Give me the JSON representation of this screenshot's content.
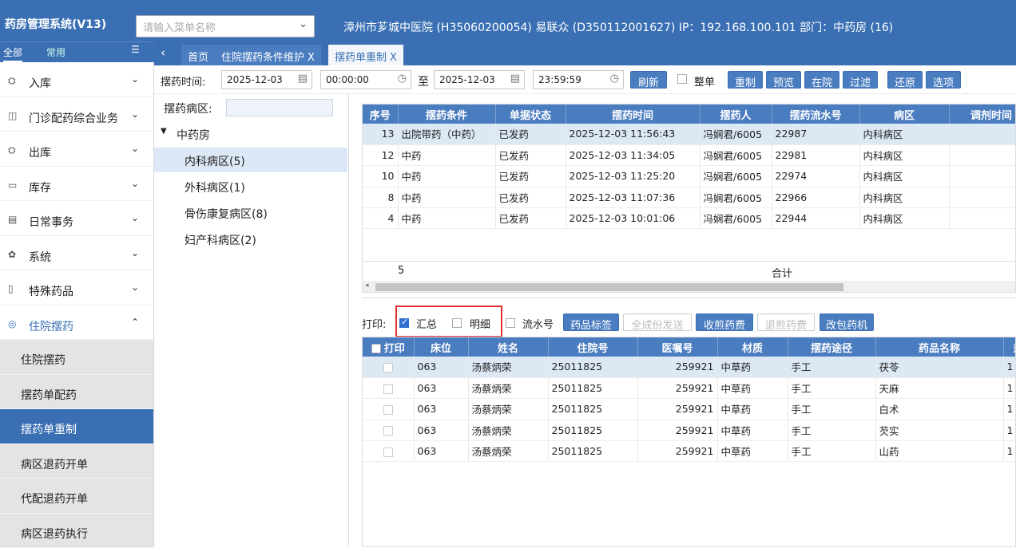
{
  "app": {
    "title": "药房管理系统(V13)",
    "menu_search_placeholder": "请输入菜单名称",
    "hospital_info": "漳州市芗城中医院 (H35060200054) 易联众 (D350112001627) IP：192.168.100.101 部门：中药房 (16)"
  },
  "sidetabs": {
    "all": "全部",
    "common": "常用"
  },
  "sidebar": {
    "menus": [
      {
        "label": "入库",
        "icon": "⛭",
        "arrow": "⌄"
      },
      {
        "label": "门诊配药综合业务",
        "icon": "◫",
        "arrow": "⌄"
      },
      {
        "label": "出库",
        "icon": "⛭",
        "arrow": "⌄"
      },
      {
        "label": "库存",
        "icon": "▭",
        "arrow": "⌄"
      },
      {
        "label": "日常事务",
        "icon": "▤",
        "arrow": "⌄"
      },
      {
        "label": "系统",
        "icon": "✿",
        "arrow": "⌄"
      },
      {
        "label": "特殊药品",
        "icon": "▯",
        "arrow": "⌄"
      },
      {
        "label": "住院摆药",
        "icon": "◎",
        "arrow": "⌃"
      }
    ],
    "subitems": [
      "住院摆药",
      "摆药单配药",
      "摆药单重制",
      "病区退药开单",
      "代配退药开单",
      "病区退药执行"
    ],
    "selected_subitem": "摆药单重制"
  },
  "tabs": [
    {
      "label": "首页"
    },
    {
      "label": "住院摆药条件维护",
      "close": "X"
    },
    {
      "label": "摆药单重制",
      "close": "X"
    }
  ],
  "toolbar": {
    "time_label": "摆药时间:",
    "start_date": "2025-12-03",
    "start_time": "00:00:00",
    "to_label": "至",
    "end_date": "2025-12-03",
    "end_time": "23:59:59",
    "refresh": "刷新",
    "whole_label": "整单",
    "whole_checked": false,
    "buttons": [
      "重制",
      "预览",
      "在院",
      "过滤",
      "还原",
      "选项"
    ]
  },
  "ward_panel": {
    "label": "摆药病区:",
    "root": "中药房",
    "wards": [
      "内科病区(5)",
      "外科病区(1)",
      "骨伤康复病区(8)",
      "妇产科病区(2)"
    ],
    "selected": "内科病区(5)"
  },
  "top_table": {
    "headers": [
      "序号",
      "摆药条件",
      "单据状态",
      "摆药时间",
      "摆药人",
      "摆药流水号",
      "病区",
      "调剂时间"
    ],
    "rows": [
      [
        "13",
        "出院带药（中药）",
        "已发药",
        "2025-12-03 11:56:43",
        "冯娴君/6005",
        "22987",
        "内科病区",
        ""
      ],
      [
        "12",
        "中药",
        "已发药",
        "2025-12-03 11:34:05",
        "冯娴君/6005",
        "22981",
        "内科病区",
        ""
      ],
      [
        "10",
        "中药",
        "已发药",
        "2025-12-03 11:25:20",
        "冯娴君/6005",
        "22974",
        "内科病区",
        ""
      ],
      [
        "8",
        "中药",
        "已发药",
        "2025-12-03 11:07:36",
        "冯娴君/6005",
        "22966",
        "内科病区",
        ""
      ],
      [
        "4",
        "中药",
        "已发药",
        "2025-12-03 10:01:06",
        "冯娴君/6005",
        "22944",
        "内科病区",
        ""
      ]
    ],
    "summary_count": "5",
    "summary_label": "合计"
  },
  "print_bar": {
    "label": "打印:",
    "summary": "汇总",
    "summary_checked": true,
    "detail": "明细",
    "detail_checked": false,
    "serial": "流水号",
    "serial_checked": false,
    "buttons": [
      {
        "label": "药品标签",
        "enabled": true
      },
      {
        "label": "全成份发送",
        "enabled": false
      },
      {
        "label": "收煎药费",
        "enabled": true
      },
      {
        "label": "退煎药费",
        "enabled": false
      },
      {
        "label": "改包药机",
        "enabled": true
      }
    ]
  },
  "bottom_table": {
    "headers": [
      "打印",
      "床位",
      "姓名",
      "住院号",
      "医嘱号",
      "材质",
      "摆药途径",
      "药品名称",
      "规"
    ],
    "rows": [
      [
        "063",
        "汤蔡炳荣",
        "25011825",
        "259921",
        "中草药",
        "手工",
        "茯苓",
        "1"
      ],
      [
        "063",
        "汤蔡炳荣",
        "25011825",
        "259921",
        "中草药",
        "手工",
        "天麻",
        "1"
      ],
      [
        "063",
        "汤蔡炳荣",
        "25011825",
        "259921",
        "中草药",
        "手工",
        "白术",
        "1"
      ],
      [
        "063",
        "汤蔡炳荣",
        "25011825",
        "259921",
        "中草药",
        "手工",
        "芡实",
        "1"
      ],
      [
        "063",
        "汤蔡炳荣",
        "25011825",
        "259921",
        "中草药",
        "手工",
        "山药",
        "1"
      ]
    ]
  }
}
